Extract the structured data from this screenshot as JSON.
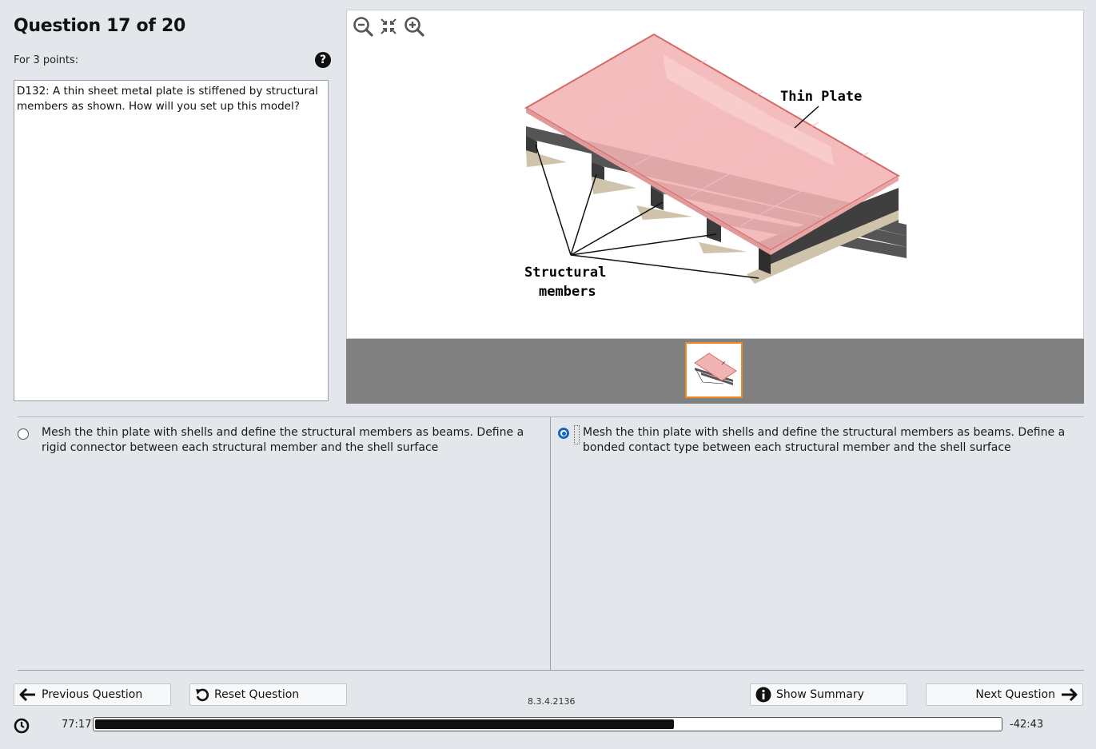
{
  "question": {
    "title": "Question 17 of 20",
    "points": "For 3 points:",
    "text": "D132: A thin sheet metal plate is stiffened by structural members as shown. How will you set up this model?"
  },
  "figure": {
    "label_plate": "Thin Plate",
    "label_members_line1": "Structural",
    "label_members_line2": "members"
  },
  "answers": [
    {
      "text": "Mesh the thin plate with shells and define the structural members as beams. Define a rigid connector between each structural member and the shell surface",
      "selected": false
    },
    {
      "text": "Mesh the thin plate with shells and define the structural members as beams. Define a bonded contact type between each structural member and the shell surface",
      "selected": true
    }
  ],
  "buttons": {
    "previous": "Previous Question",
    "reset": "Reset Question",
    "summary": "Show Summary",
    "next": "Next Question"
  },
  "version": "8.3.4.2136",
  "timer": {
    "elapsed": "77:17",
    "remaining": "-42:43",
    "progress_fraction": 0.64
  },
  "colors": {
    "accent": "#1565c0",
    "thumb_border": "#f08a1c",
    "plate": "#f2b3b3"
  }
}
